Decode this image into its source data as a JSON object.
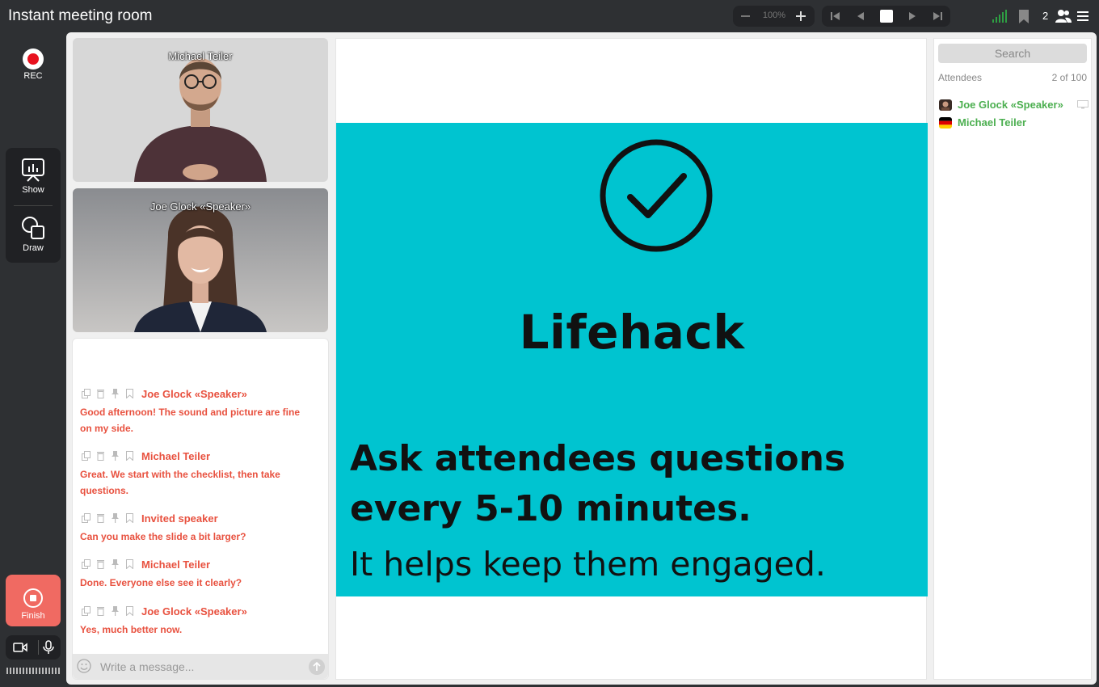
{
  "window": {
    "title": "Instant meeting room"
  },
  "toolbar": {
    "zoom_value": "100%",
    "attendee_count": "2"
  },
  "left_rail": {
    "rec_label": "REC",
    "show_label": "Show",
    "draw_label": "Draw",
    "finish_label": "Finish"
  },
  "videos": [
    {
      "name": "Michael Teiler"
    },
    {
      "name": "Joe Glock «Speaker»"
    }
  ],
  "chat": {
    "messages": [
      {
        "author": "Joe Glock «Speaker»",
        "text": "Good afternoon! The sound and picture are fine on my side."
      },
      {
        "author": "Michael Teiler",
        "text": "Great. We start with the checklist, then take questions."
      },
      {
        "author": "Invited speaker",
        "text": "Can you make the slide a bit larger?"
      },
      {
        "author": "Michael Teiler",
        "text": "Done. Everyone else see it clearly?"
      },
      {
        "author": "Joe Glock «Speaker»",
        "text": "Yes, much better now."
      }
    ],
    "placeholder": "Write a message...",
    "text_color": "#e8513f"
  },
  "slide": {
    "heading": "Lifehack",
    "line1": "Ask attendees questions",
    "line2": "every 5-10 minutes.",
    "line3": "It helps keep them engaged.",
    "background": "#00c4d0"
  },
  "attendees": {
    "search_placeholder": "Search",
    "label": "Attendees",
    "count": "2 of 100",
    "list": [
      {
        "name": "Joe Glock «Speaker»",
        "icon": "avatar-icon"
      },
      {
        "name": "Michael Teiler",
        "icon": "german-flag-icon"
      }
    ],
    "name_color": "#4caf50"
  },
  "colors": {
    "record": "#e8121f",
    "finish": "#f06a62",
    "signal": "#2ea043"
  }
}
